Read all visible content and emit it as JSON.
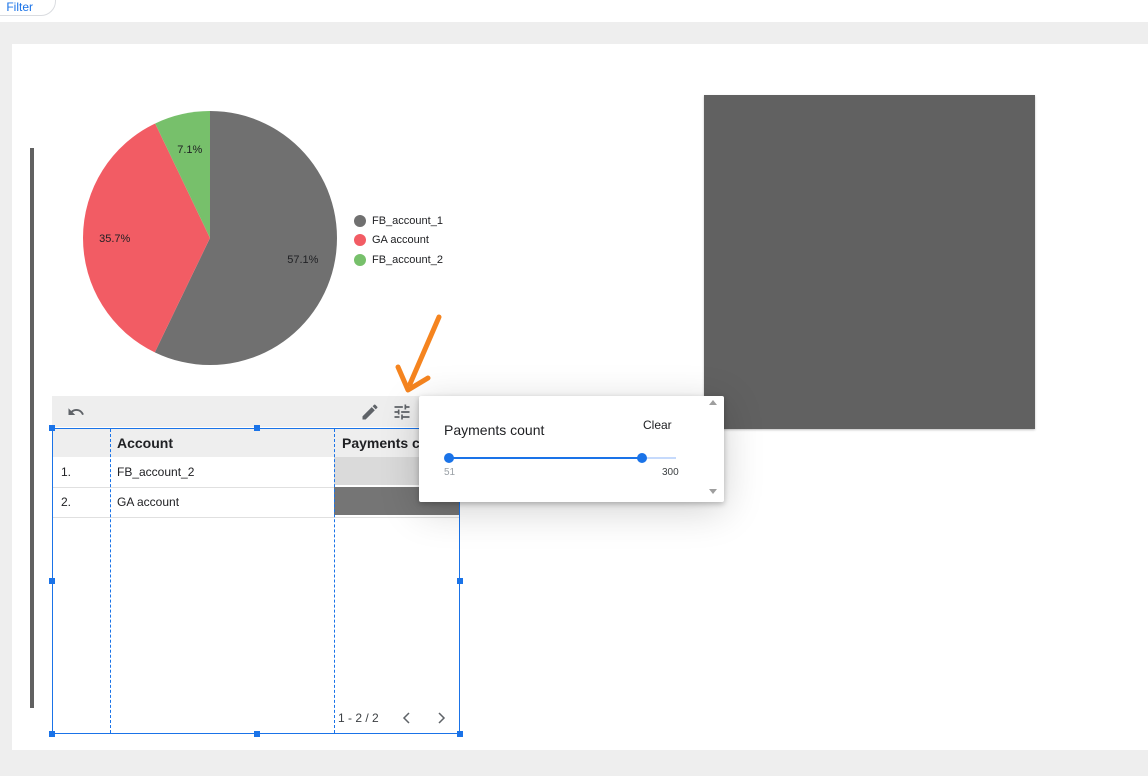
{
  "header": {
    "button_label": "Filter"
  },
  "chart_data": {
    "type": "pie",
    "categories": [
      "FB_account_1",
      "GA account",
      "FB_account_2"
    ],
    "values": [
      57.1,
      35.7,
      7.1
    ],
    "labels": [
      "57.1%",
      "35.7%",
      "7.1%"
    ],
    "colors": [
      "#707070",
      "#f25c64",
      "#77c06b"
    ],
    "legend_position": "right"
  },
  "table": {
    "columns": [
      "Account",
      "Payments co"
    ],
    "rows": [
      {
        "index": "1.",
        "account": "FB_account_2"
      },
      {
        "index": "2.",
        "account": "GA account"
      }
    ],
    "pagination": "1 - 2 / 2",
    "prev_icon": "chevron-left-icon",
    "next_icon": "chevron-right-icon"
  },
  "toolbar": {
    "undo_icon": "undo-icon",
    "edit_icon": "pencil-icon",
    "filter_icon": "tune-icon"
  },
  "filter_popup": {
    "title": "Payments count",
    "clear_label": "Clear",
    "min_value": "51",
    "max_value": "300",
    "range": [
      51,
      300
    ]
  },
  "colors": {
    "accent": "#1a73e8",
    "annotation_arrow": "#f5841f",
    "panel_gray": "#616161"
  }
}
